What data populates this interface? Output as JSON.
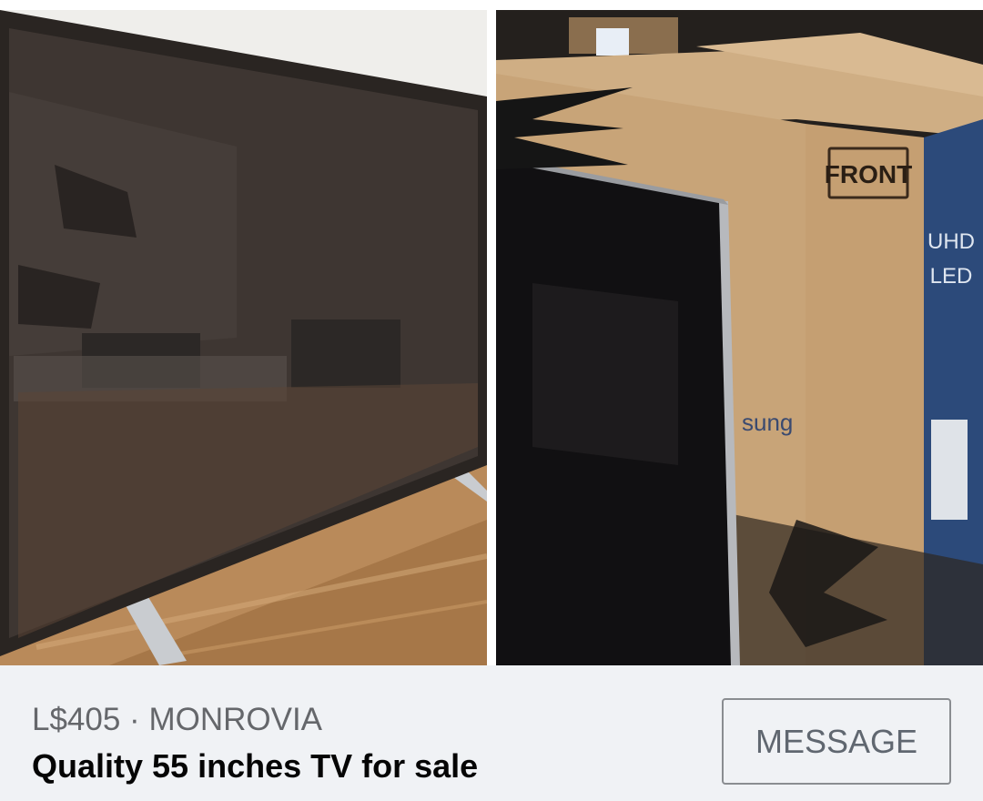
{
  "listing": {
    "price": "L$405",
    "separator": " · ",
    "location": "MONROVIA",
    "title": "Quality 55 inches TV for sale",
    "message_label": "MESSAGE"
  },
  "photos": {
    "left": {
      "subject": "tv-on-table-photo"
    },
    "right": {
      "subject": "tv-in-front-of-boxes-photo",
      "box_front_label": "FRONT",
      "box_side_text_1": "UHD",
      "box_side_text_2": "LED",
      "box_brand_partial": "sung"
    }
  },
  "colors": {
    "background": "#f0f2f5",
    "price_text": "#65676b",
    "title_text": "#050505",
    "button_border": "#8a8d91",
    "button_text": "#606770",
    "cardboard": "#c8a478",
    "box_blue": "#2c4a7a"
  }
}
